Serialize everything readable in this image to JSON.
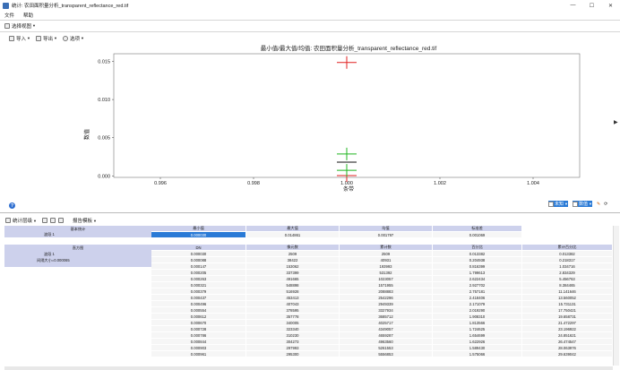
{
  "window": {
    "title": "统计: 农田面积量分析_transparent_reflectance_red.tif",
    "minimize": "—",
    "maximize": "☐",
    "close": "✕"
  },
  "menu": [
    "文件",
    "帮助"
  ],
  "view_select": {
    "label": "选择视图"
  },
  "chart_toolbar": {
    "import": "导入",
    "export": "导出",
    "options": "选项"
  },
  "chart_data": {
    "type": "scatter",
    "title": "最小值/最大值/均值: 农田面积量分析_transparent_reflectance_red.tif",
    "xlabel": "条带",
    "ylabel": "数值",
    "xlim": [
      0.995,
      1.005
    ],
    "ylim": [
      -0.0002,
      0.016
    ],
    "x_ticks": [
      "0.996",
      "0.998",
      "1.000",
      "1.002",
      "1.004"
    ],
    "y_ticks": [
      "0.000",
      "0.005",
      "0.010",
      "0.015"
    ],
    "series": [
      {
        "color": "#e02020",
        "points": [
          {
            "x": 1.0,
            "y": 0.014861
          },
          {
            "x": 1.0,
            "y": 3e-05
          }
        ]
      },
      {
        "color": "#1fb51f",
        "points": [
          {
            "x": 1.0,
            "y": 0.002866
          },
          {
            "x": 1.0,
            "y": 0.000728
          }
        ]
      },
      {
        "color": "#111111",
        "points": [
          {
            "x": 1.0,
            "y": 0.001797
          }
        ]
      }
    ]
  },
  "zoom": {
    "mode": "未知",
    "value": "数值"
  },
  "stats_toolbar": {
    "stats_layer": "统计层级",
    "report_format": "报告模板"
  },
  "basic": {
    "title": "基本统计",
    "band": "波段 1",
    "headers": [
      "最小值",
      "最大值",
      "均值",
      "标准差"
    ],
    "values": [
      "0.000030",
      "0.014861",
      "0.001797",
      "0.001069"
    ]
  },
  "histogram": {
    "title": "直方图",
    "band": "波段 1",
    "binsize": "间隔大小=0.000065",
    "headers": [
      "DN",
      "像元数",
      "累计数",
      "百分比",
      "累计百分比"
    ],
    "rows": [
      [
        "0.000030",
        "2509",
        "2509",
        "0.013382",
        "0.013382"
      ],
      [
        "0.000088",
        "38422",
        "40931",
        "0.204938",
        "0.218317"
      ],
      [
        "0.000147",
        "153062",
        "193993",
        "0.816399",
        "1.034716"
      ],
      [
        "0.000205",
        "337399",
        "531392",
        "1.799613",
        "2.834329"
      ],
      [
        "0.000263",
        "491665",
        "1023057",
        "2.622434",
        "5.456763"
      ],
      [
        "0.000321",
        "548898",
        "1571955",
        "2.927702",
        "8.384465"
      ],
      [
        "0.000379",
        "516928",
        "2088883",
        "2.757181",
        "11.141646"
      ],
      [
        "0.000437",
        "453413",
        "2542296",
        "2.418406",
        "13.560052"
      ],
      [
        "0.000496",
        "407043",
        "2949339",
        "2.171079",
        "15.731131"
      ],
      [
        "0.000554",
        "378595",
        "3327934",
        "2.019290",
        "17.750421"
      ],
      [
        "0.000612",
        "357778",
        "3685712",
        "1.908310",
        "19.658731"
      ],
      [
        "0.000670",
        "340005",
        "4025717",
        "1.813566",
        "21.472297"
      ],
      [
        "0.000728",
        "323340",
        "4349057",
        "1.724625",
        "23.196922"
      ],
      [
        "0.000786",
        "310230",
        "4659287",
        "1.654699",
        "24.851621"
      ],
      [
        "0.000844",
        "304273",
        "4963560",
        "1.622926",
        "26.474547"
      ],
      [
        "0.000903",
        "297993",
        "5261553",
        "1.589430",
        "28.063976"
      ],
      [
        "0.000961",
        "295300",
        "5556853",
        "1.575066",
        "29.639042"
      ]
    ]
  }
}
